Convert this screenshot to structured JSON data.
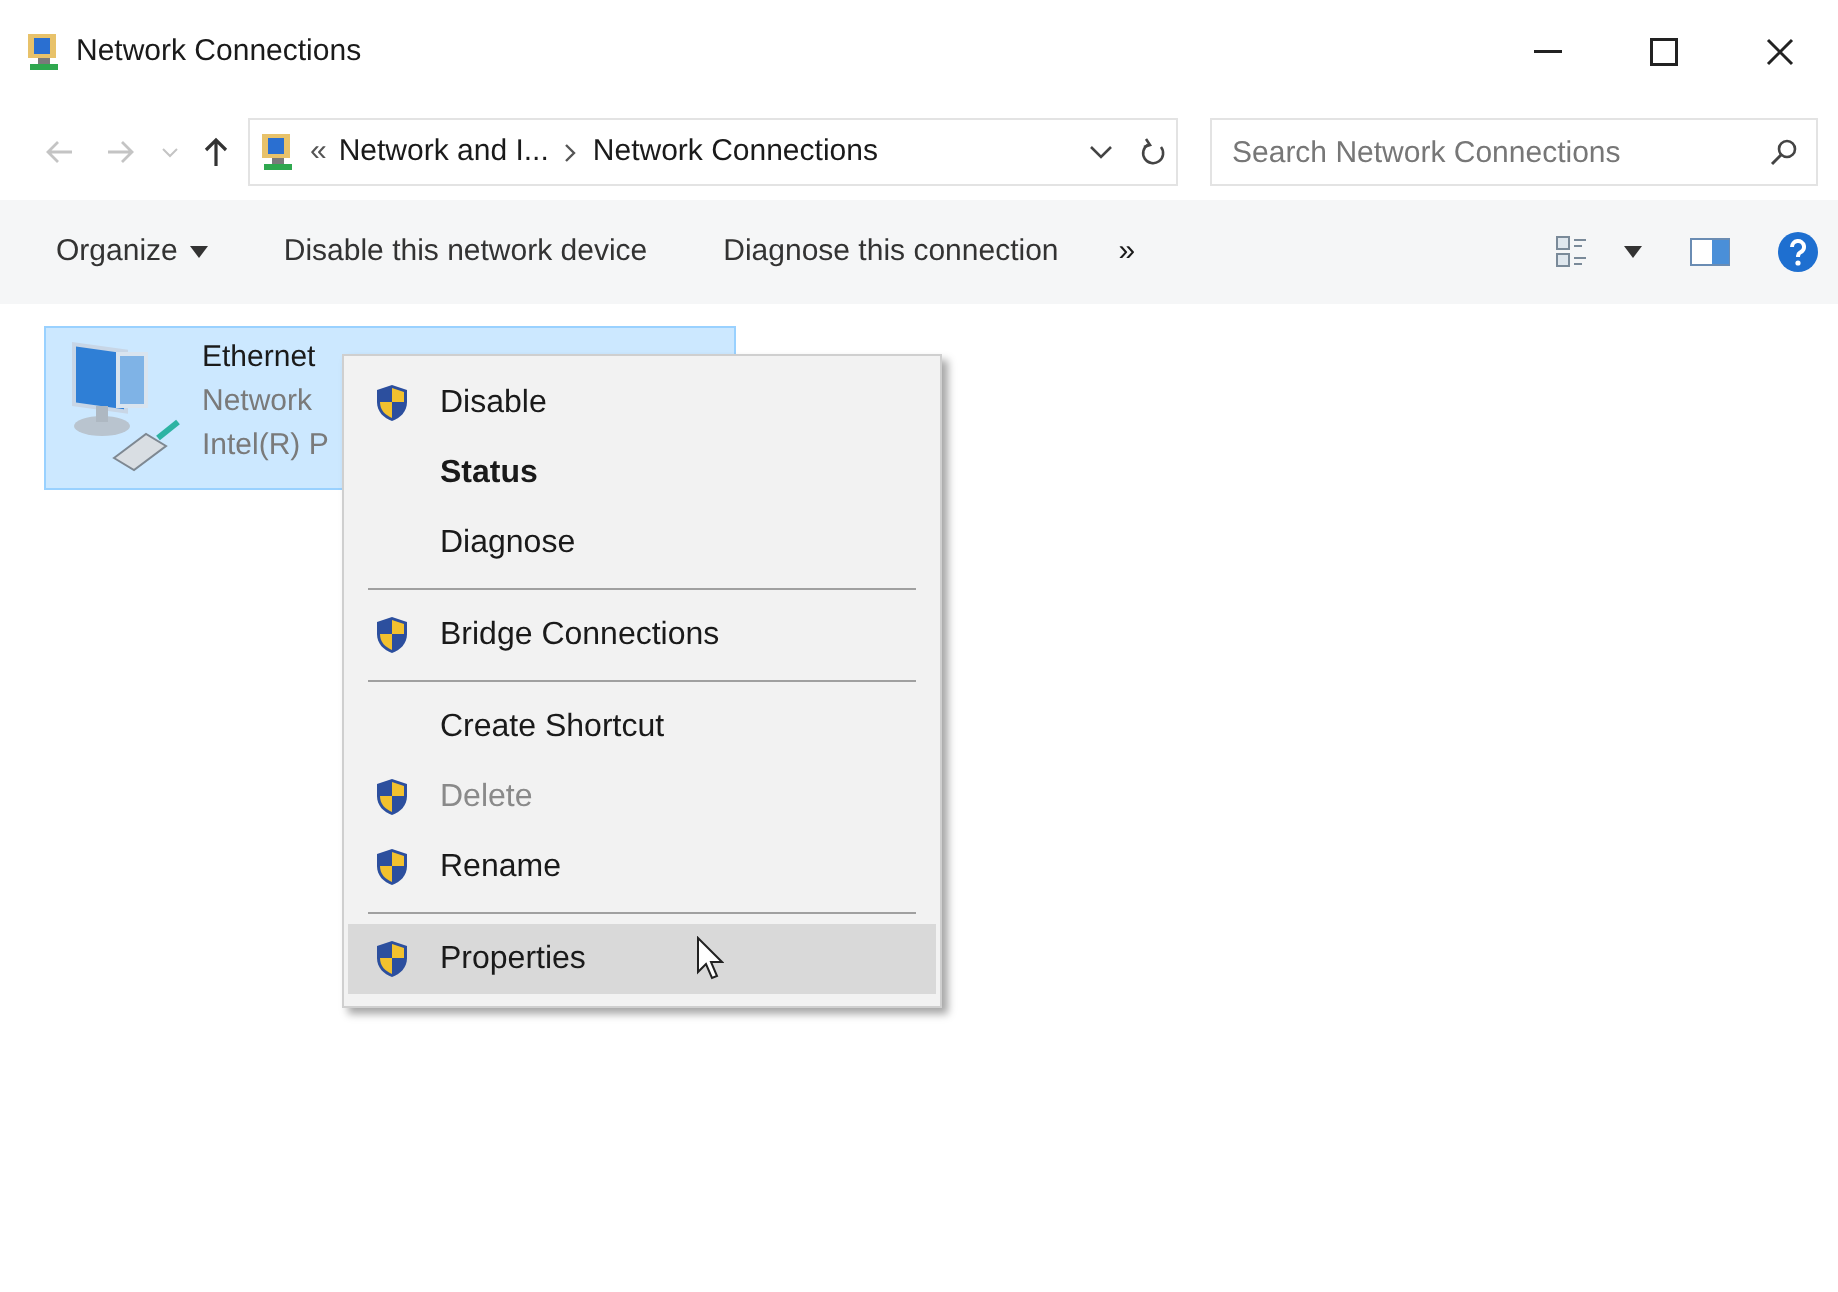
{
  "window": {
    "title": "Network Connections"
  },
  "address": {
    "overflow": "«",
    "crumbs": [
      "Network and I...",
      "Network Connections"
    ]
  },
  "search": {
    "placeholder": "Search Network Connections"
  },
  "toolbar": {
    "items": [
      {
        "label": "Organize",
        "dropdown": true
      },
      {
        "label": "Disable this network device",
        "dropdown": false
      },
      {
        "label": "Diagnose this connection",
        "dropdown": false
      }
    ],
    "more": "»"
  },
  "connections": [
    {
      "name": "Ethernet",
      "status": "Network",
      "adapter": "Intel(R) P",
      "selected": true
    }
  ],
  "context_menu": [
    {
      "kind": "item",
      "label": "Disable",
      "shield": true,
      "bold": false,
      "disabled": false,
      "selected": false
    },
    {
      "kind": "item",
      "label": "Status",
      "shield": false,
      "bold": true,
      "disabled": false,
      "selected": false
    },
    {
      "kind": "item",
      "label": "Diagnose",
      "shield": false,
      "bold": false,
      "disabled": false,
      "selected": false
    },
    {
      "kind": "separator"
    },
    {
      "kind": "item",
      "label": "Bridge Connections",
      "shield": true,
      "bold": false,
      "disabled": false,
      "selected": false
    },
    {
      "kind": "separator"
    },
    {
      "kind": "item",
      "label": "Create Shortcut",
      "shield": false,
      "bold": false,
      "disabled": false,
      "selected": false
    },
    {
      "kind": "item",
      "label": "Delete",
      "shield": true,
      "bold": false,
      "disabled": true,
      "selected": false
    },
    {
      "kind": "item",
      "label": "Rename",
      "shield": true,
      "bold": false,
      "disabled": false,
      "selected": false
    },
    {
      "kind": "separator"
    },
    {
      "kind": "item",
      "label": "Properties",
      "shield": true,
      "bold": false,
      "disabled": false,
      "selected": true
    }
  ]
}
